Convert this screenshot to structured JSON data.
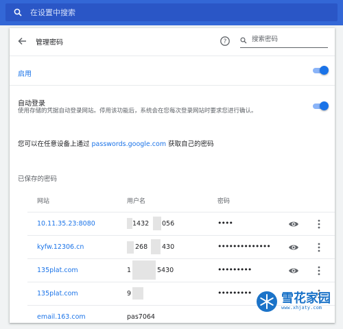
{
  "search": {
    "placeholder": "在设置中搜索"
  },
  "header": {
    "title": "管理密码",
    "password_search_placeholder": "搜索密码"
  },
  "enable": {
    "label": "启用",
    "on": true
  },
  "autologin": {
    "title": "自动登录",
    "description": "使用存储的凭据自动登录网站。停用该功能后，系统会在您每次登录网站时要求您进行确认。",
    "on": true
  },
  "manage": {
    "prefix": "您可以在任意设备上通过 ",
    "link": "passwords.google.com",
    "suffix": " 获取自己的密码"
  },
  "saved": {
    "heading": "已保存的密码",
    "columns": {
      "site": "网站",
      "username": "用户名",
      "password": "密码"
    },
    "rows": [
      {
        "site": "10.11.35.23:8080",
        "username": "1432",
        "username_end": "056",
        "password": "••••"
      },
      {
        "site": "kyfw.12306.cn",
        "username": "268",
        "username_end": "430",
        "password": "••••••••••••••"
      },
      {
        "site": "135plat.com",
        "username": "1",
        "username_end": "5430",
        "password": "•••••••••"
      },
      {
        "site": "135plat.com",
        "username": "9",
        "username_end": "",
        "password": "•••••••••"
      },
      {
        "site": "email.163.com",
        "username": "pas7064",
        "username_end": "",
        "password": ""
      }
    ]
  },
  "colors": {
    "accent": "#1a73e8",
    "topbar": "#3367d6",
    "watermark": "#1b73c8"
  },
  "watermark": {
    "text": "雪花家园",
    "sub": "www.xhjaty.com"
  }
}
